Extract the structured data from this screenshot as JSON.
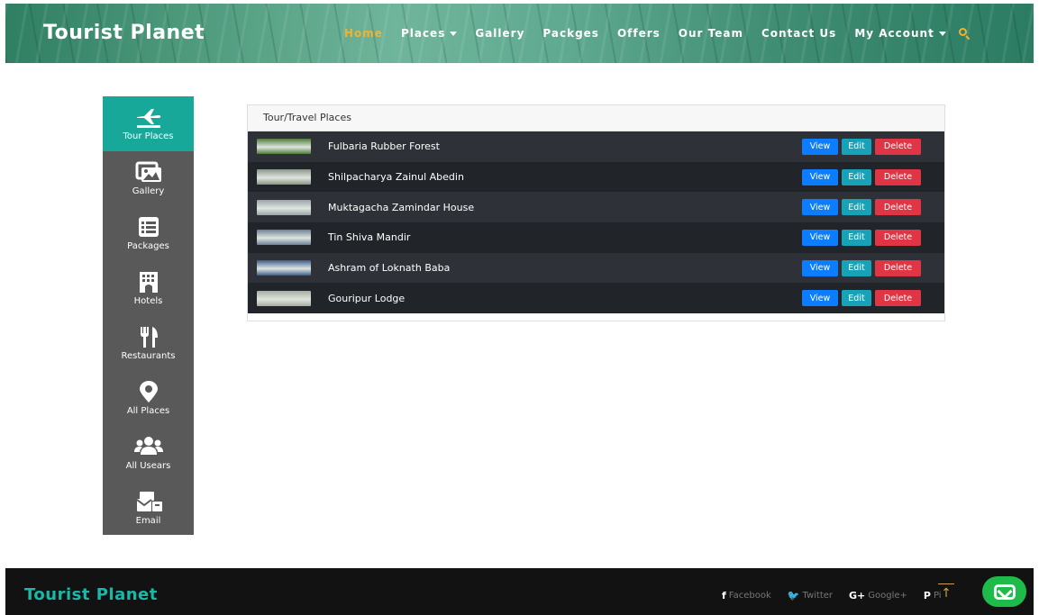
{
  "header": {
    "brand": "Tourist Planet",
    "nav": [
      {
        "label": "Home",
        "active": true
      },
      {
        "label": "Places",
        "dropdown": true
      },
      {
        "label": "Gallery"
      },
      {
        "label": "Packges"
      },
      {
        "label": "Offers"
      },
      {
        "label": "Our Team"
      },
      {
        "label": "Contact Us"
      },
      {
        "label": "My Account",
        "dropdown": true
      }
    ],
    "search_icon": "search-icon"
  },
  "sidebar": {
    "items": [
      {
        "label": "Tour Places",
        "icon": "plane-icon",
        "active": true
      },
      {
        "label": "Gallery",
        "icon": "images-icon"
      },
      {
        "label": "Packages",
        "icon": "list-icon"
      },
      {
        "label": "Hotels",
        "icon": "hotel-icon"
      },
      {
        "label": "Restaurants",
        "icon": "utensils-icon"
      },
      {
        "label": "All Places",
        "icon": "map-marker-icon"
      },
      {
        "label": "All Usears",
        "icon": "users-icon"
      },
      {
        "label": "Email",
        "icon": "mail-bulk-icon"
      }
    ]
  },
  "panel": {
    "title": "Tour/Travel Places",
    "buttons": {
      "view": "View",
      "edit": "Edit",
      "delete": "Delete"
    },
    "rows": [
      {
        "name": "Fulbaria Rubber Forest",
        "thumb_color": "#4f7a3a"
      },
      {
        "name": "Shilpacharya Zainul Abedin",
        "thumb_color": "#8a9488"
      },
      {
        "name": "Muktagacha Zamindar House",
        "thumb_color": "#9aa3a8"
      },
      {
        "name": "Tin Shiva Mandir",
        "thumb_color": "#6c7f95"
      },
      {
        "name": "Ashram of Loknath Baba",
        "thumb_color": "#3b5d8f"
      },
      {
        "name": "Gouripur Lodge",
        "thumb_color": "#a9ad9f"
      }
    ]
  },
  "footer": {
    "brand": "Tourist Planet",
    "social": [
      {
        "icon": "f",
        "label": "Facebook"
      },
      {
        "icon": "🐦",
        "label": "Twitter"
      },
      {
        "icon": "G+",
        "label": "Google+"
      },
      {
        "icon": "P",
        "label": "Pi"
      }
    ],
    "scroll_top": "↑"
  },
  "colors": {
    "accent": "#17a89a",
    "nav_active": "#f0b330",
    "view": "#0d7dff",
    "edit": "#17a2b8",
    "delete": "#e03545",
    "chat": "#1fbb4a"
  }
}
